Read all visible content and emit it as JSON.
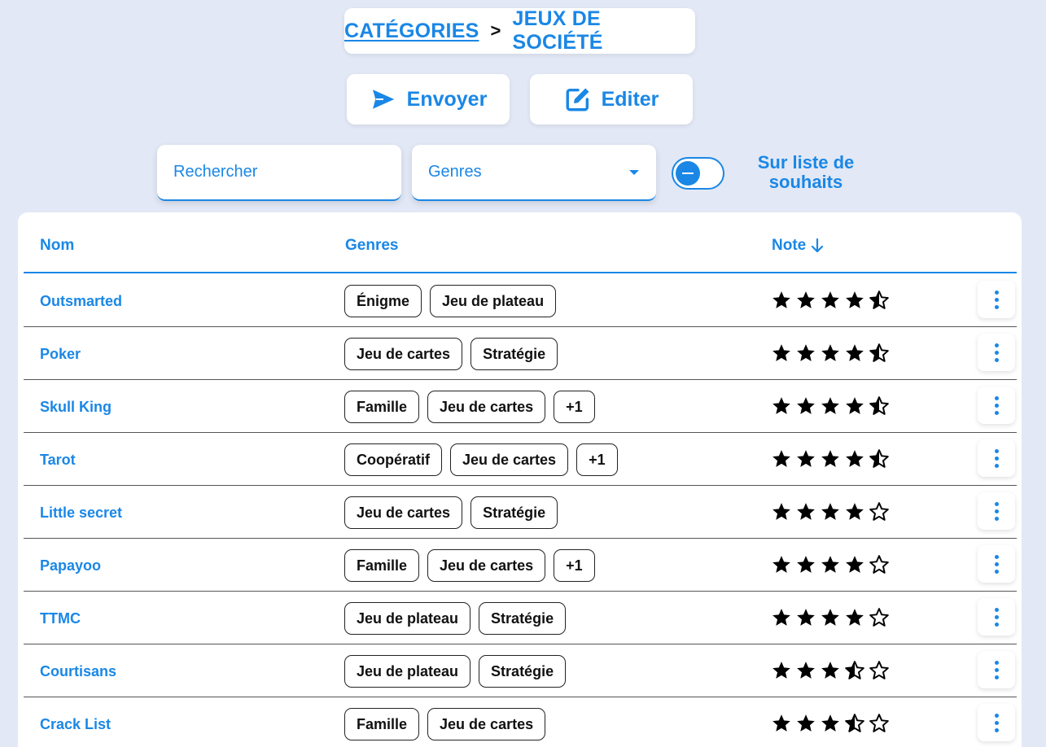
{
  "breadcrumb": {
    "parent": "CATÉGORIES",
    "separator": ">",
    "current": "JEUX DE SOCIÉTÉ"
  },
  "actions": {
    "send_label": "Envoyer",
    "edit_label": "Editer"
  },
  "filters": {
    "search_placeholder": "Rechercher",
    "genres_label": "Genres",
    "wishlist_label": "Sur liste de souhaits"
  },
  "table": {
    "columns": {
      "name": "Nom",
      "genres": "Genres",
      "rating": "Note"
    },
    "rows": [
      {
        "name": "Outsmarted",
        "tags": [
          "Énigme",
          "Jeu de plateau"
        ],
        "rating": 4.5
      },
      {
        "name": "Poker",
        "tags": [
          "Jeu de cartes",
          "Stratégie"
        ],
        "rating": 4.5
      },
      {
        "name": "Skull King",
        "tags": [
          "Famille",
          "Jeu de cartes",
          "+1"
        ],
        "rating": 4.5
      },
      {
        "name": "Tarot",
        "tags": [
          "Coopératif",
          "Jeu de cartes",
          "+1"
        ],
        "rating": 4.5
      },
      {
        "name": "Little secret",
        "tags": [
          "Jeu de cartes",
          "Stratégie"
        ],
        "rating": 4
      },
      {
        "name": "Papayoo",
        "tags": [
          "Famille",
          "Jeu de cartes",
          "+1"
        ],
        "rating": 4
      },
      {
        "name": "TTMC",
        "tags": [
          "Jeu de plateau",
          "Stratégie"
        ],
        "rating": 4
      },
      {
        "name": "Courtisans",
        "tags": [
          "Jeu de plateau",
          "Stratégie"
        ],
        "rating": 3.5
      },
      {
        "name": "Crack List",
        "tags": [
          "Famille",
          "Jeu de cartes"
        ],
        "rating": 3.5
      }
    ]
  },
  "colors": {
    "accent": "#1a87e6",
    "background": "#e2e8f5"
  }
}
